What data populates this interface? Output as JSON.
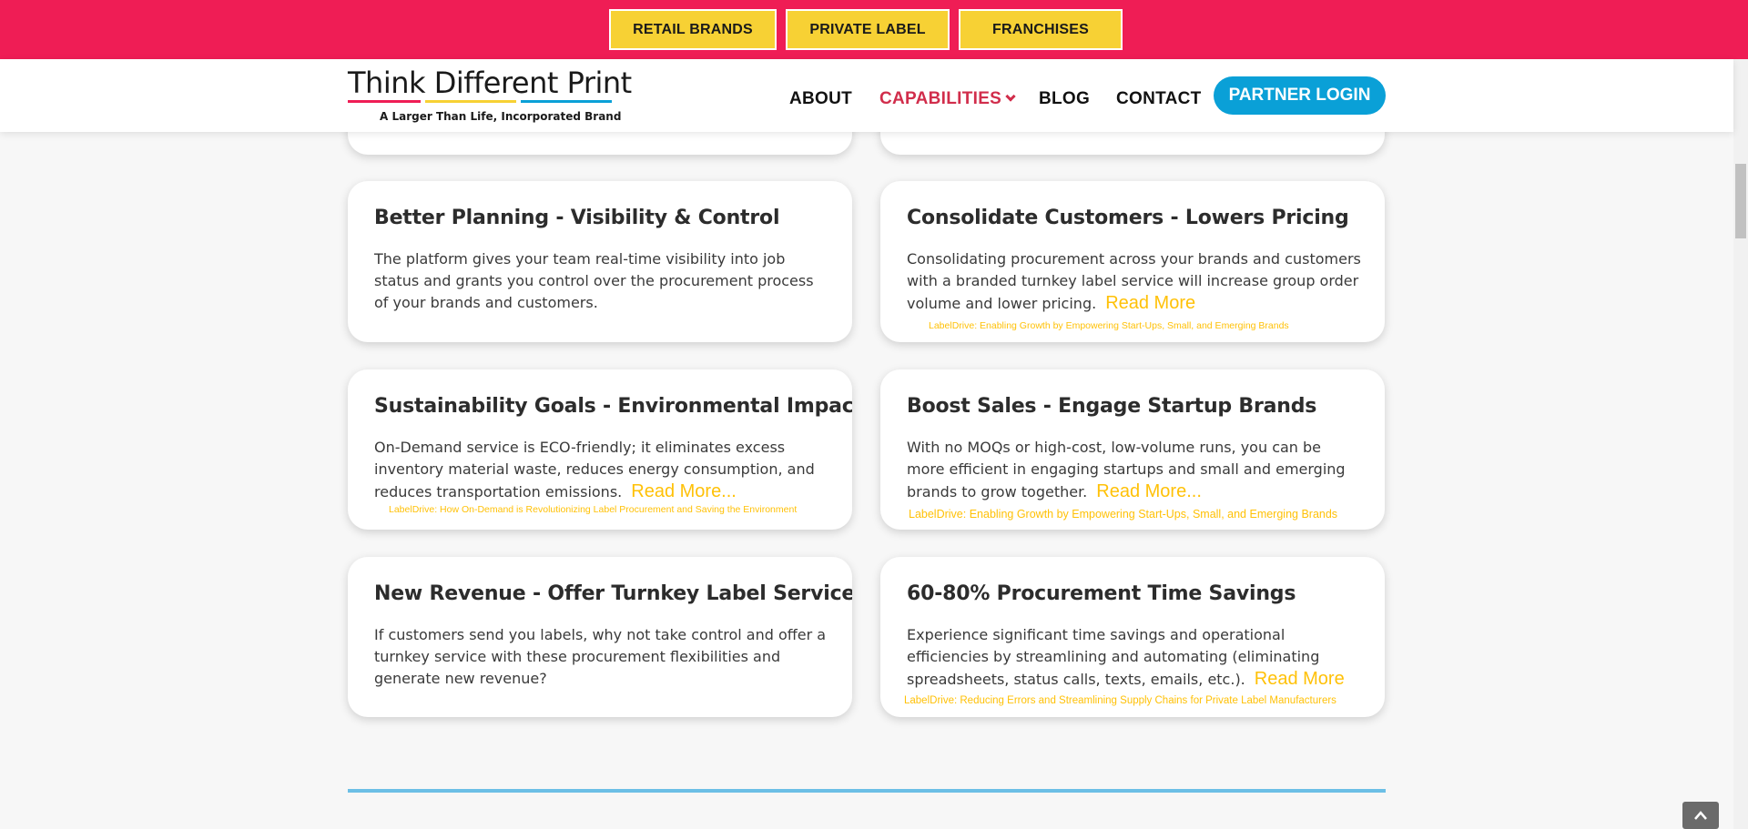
{
  "topbar": {
    "buttons": [
      "RETAIL BRANDS",
      "PRIVATE LABEL",
      "FRANCHISES"
    ]
  },
  "header": {
    "logo": {
      "title": "Think Different Print",
      "tagline": "A Larger Than Life, Incorporated Brand"
    },
    "nav": [
      "ABOUT",
      "CAPABILITIES",
      "BLOG",
      "CONTACT"
    ],
    "login": "PARTNER LOGIN"
  },
  "cards": [
    {
      "title": "Better Planning - Visibility & Control",
      "text": "The platform gives your team real-time visibility into job status and grants you control over the procurement process of your brands and customers."
    },
    {
      "title": "Consolidate Customers - Lowers Pricing",
      "text": "Consolidating procurement across your brands and customers with a branded turnkey label service will increase group order volume and lower pricing.",
      "read_more": "Read More",
      "link": "LabelDrive: Enabling Growth by Empowering Start-Ups, Small, and Emerging Brands"
    },
    {
      "title": "Sustainability Goals - Environmental Impact",
      "text": "On-Demand service is ECO-friendly; it eliminates excess inventory material waste, reduces energy consumption, and reduces transportation emissions.",
      "read_more": "Read More...",
      "link": "LabelDrive: How On-Demand is Revolutionizing Label Procurement and Saving the Environment"
    },
    {
      "title": "Boost Sales - Engage Startup Brands",
      "text": "With no MOQs or high-cost, low-volume runs, you can be more efficient in engaging startups and small and emerging brands to grow together.",
      "read_more": "Read More...",
      "link": "LabelDrive: Enabling Growth by Empowering Start-Ups, Small, and Emerging Brands"
    },
    {
      "title": "New Revenue - Offer Turnkey Label Service",
      "text": "If customers send you labels, why not take control and offer a turnkey service with these procurement flexibilities and generate new revenue?"
    },
    {
      "title": "60-80% Procurement Time Savings",
      "text": "Experience significant time savings and operational efficiencies by streamlining and automating (eliminating spreadsheets, status calls, texts, emails, etc.).",
      "read_more": "Read More",
      "link": "LabelDrive: Reducing Errors and Streamlining Supply Chains for Private Label Manufacturers"
    }
  ],
  "colors": {
    "topbar": "#ef1d55",
    "topbar_button": "#f7d134",
    "nav_active": "#d12d4b",
    "login_button": "#0aa0d7",
    "read_more": "#ffc107",
    "divider": "#6cbfe6"
  },
  "icons": [
    "chevron-down-icon",
    "arrow-up-icon"
  ]
}
